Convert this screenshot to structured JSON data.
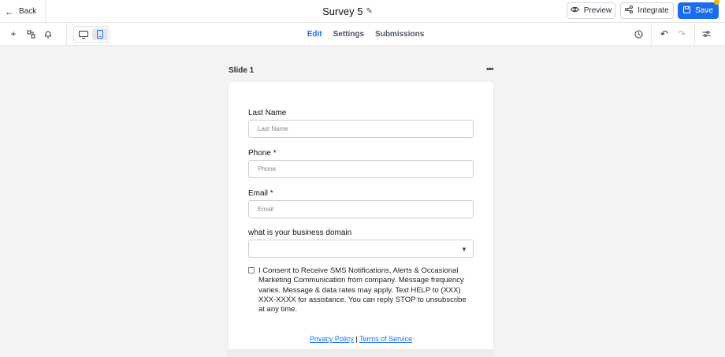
{
  "header": {
    "back_label": "Back",
    "title": "Survey 5",
    "preview_label": "Preview",
    "integrate_label": "Integrate",
    "save_label": "Save"
  },
  "toolbar": {
    "tabs": [
      {
        "label": "Edit",
        "active": true
      },
      {
        "label": "Settings",
        "active": false
      },
      {
        "label": "Submissions",
        "active": false
      }
    ]
  },
  "slide": {
    "label": "Slide 1",
    "fields": [
      {
        "label": "Last Name",
        "placeholder": "Last Name"
      },
      {
        "label": "Phone *",
        "placeholder": "Phone"
      },
      {
        "label": "Email *",
        "placeholder": "Email"
      },
      {
        "label": "what is your business domain",
        "placeholder": ""
      }
    ],
    "consent_text": "I Consent to Receive SMS Notifications, Alerts & Occasional Marketing Communication from company. Message frequency varies. Message & data rates may apply. Text HELP to (XXX) XXX-XXXX for assistance. You can reply STOP to unsubscribe at any time.",
    "privacy_label": "Privacy Policy",
    "separator": "|",
    "terms_label": "Terms of Service"
  },
  "colors": {
    "accent": "#1a6df0",
    "notification_dot": "#f5b400",
    "canvas": "#f3f3f3"
  }
}
